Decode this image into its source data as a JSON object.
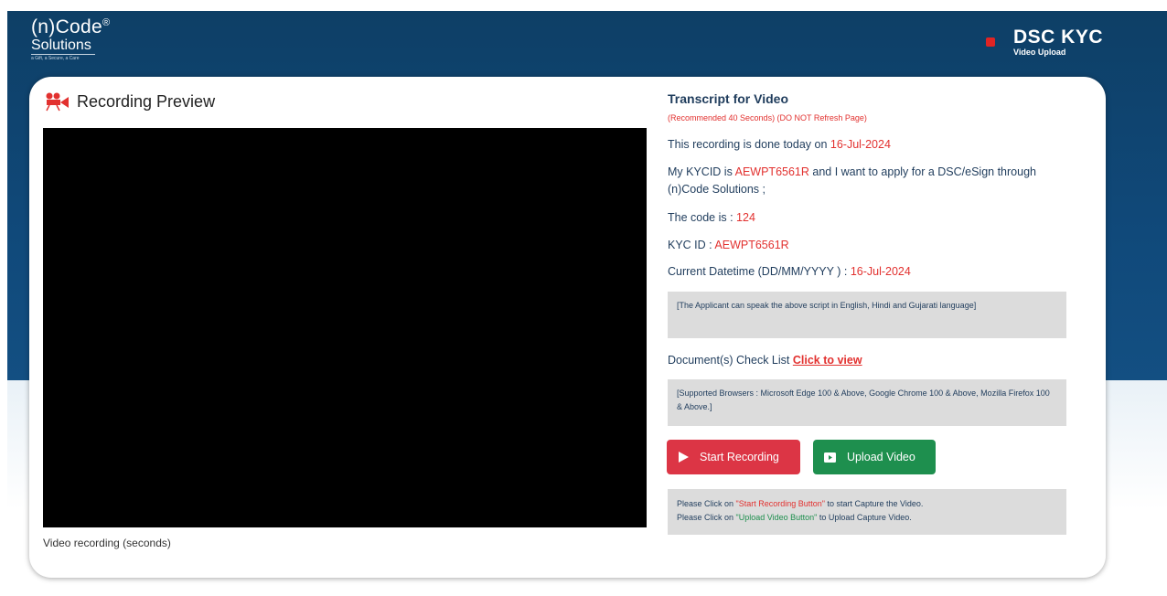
{
  "header": {
    "logo_line1": "(n)Code",
    "logo_reg": "®",
    "logo_line2": "Solutions",
    "logo_tagline": "a Gift, a Secure, a Care",
    "brand_title": "DSC KYC",
    "brand_subtitle": "Video Upload"
  },
  "preview": {
    "title": "Recording Preview",
    "caption": "Video recording (seconds)"
  },
  "transcript": {
    "title": "Transcript for Video",
    "subtitle": "(Recommended 40 Seconds) (DO NOT Refresh Page)",
    "date_prefix": "This recording is done today on ",
    "date_value": "16-Jul-2024",
    "kyc_prefix": "My KYCID is ",
    "kyc_value": "AEWPT6561R",
    "kyc_suffix": " and I want to apply for a DSC/eSign through (n)Code Solutions ;",
    "code_prefix": "The code is : ",
    "code_value": "124",
    "kycid_prefix": "KYC ID : ",
    "kycid_value": "AEWPT6561R",
    "datetime_prefix": "Current Datetime (DD/MM/YYYY ) : ",
    "datetime_value": "16-Jul-2024",
    "language_note": "[The Applicant can speak the above script in English, Hindi and Gujarati language]",
    "checklist_prefix": "Document(s) Check List ",
    "checklist_link": "Click to view",
    "browsers_note": "[Supported Browsers : Microsoft Edge 100 & Above, Google Chrome 100 & Above, Mozilla Firefox 100 & Above.]"
  },
  "buttons": {
    "start_label": "Start Recording",
    "upload_label": "Upload Video"
  },
  "hint": {
    "line1_prefix": "Please Click on ",
    "line1_highlight": "\"Start Recording Button\"",
    "line1_suffix": " to start Capture the Video.",
    "line2_prefix": "Please Click on ",
    "line2_highlight": "\"Upload Video Button\"",
    "line2_suffix": " to Upload Capture Video."
  },
  "colors": {
    "banner": "#10497a",
    "accent_red": "#e2312f",
    "start_button": "#dc3545",
    "upload_button": "#1e8f4e"
  }
}
